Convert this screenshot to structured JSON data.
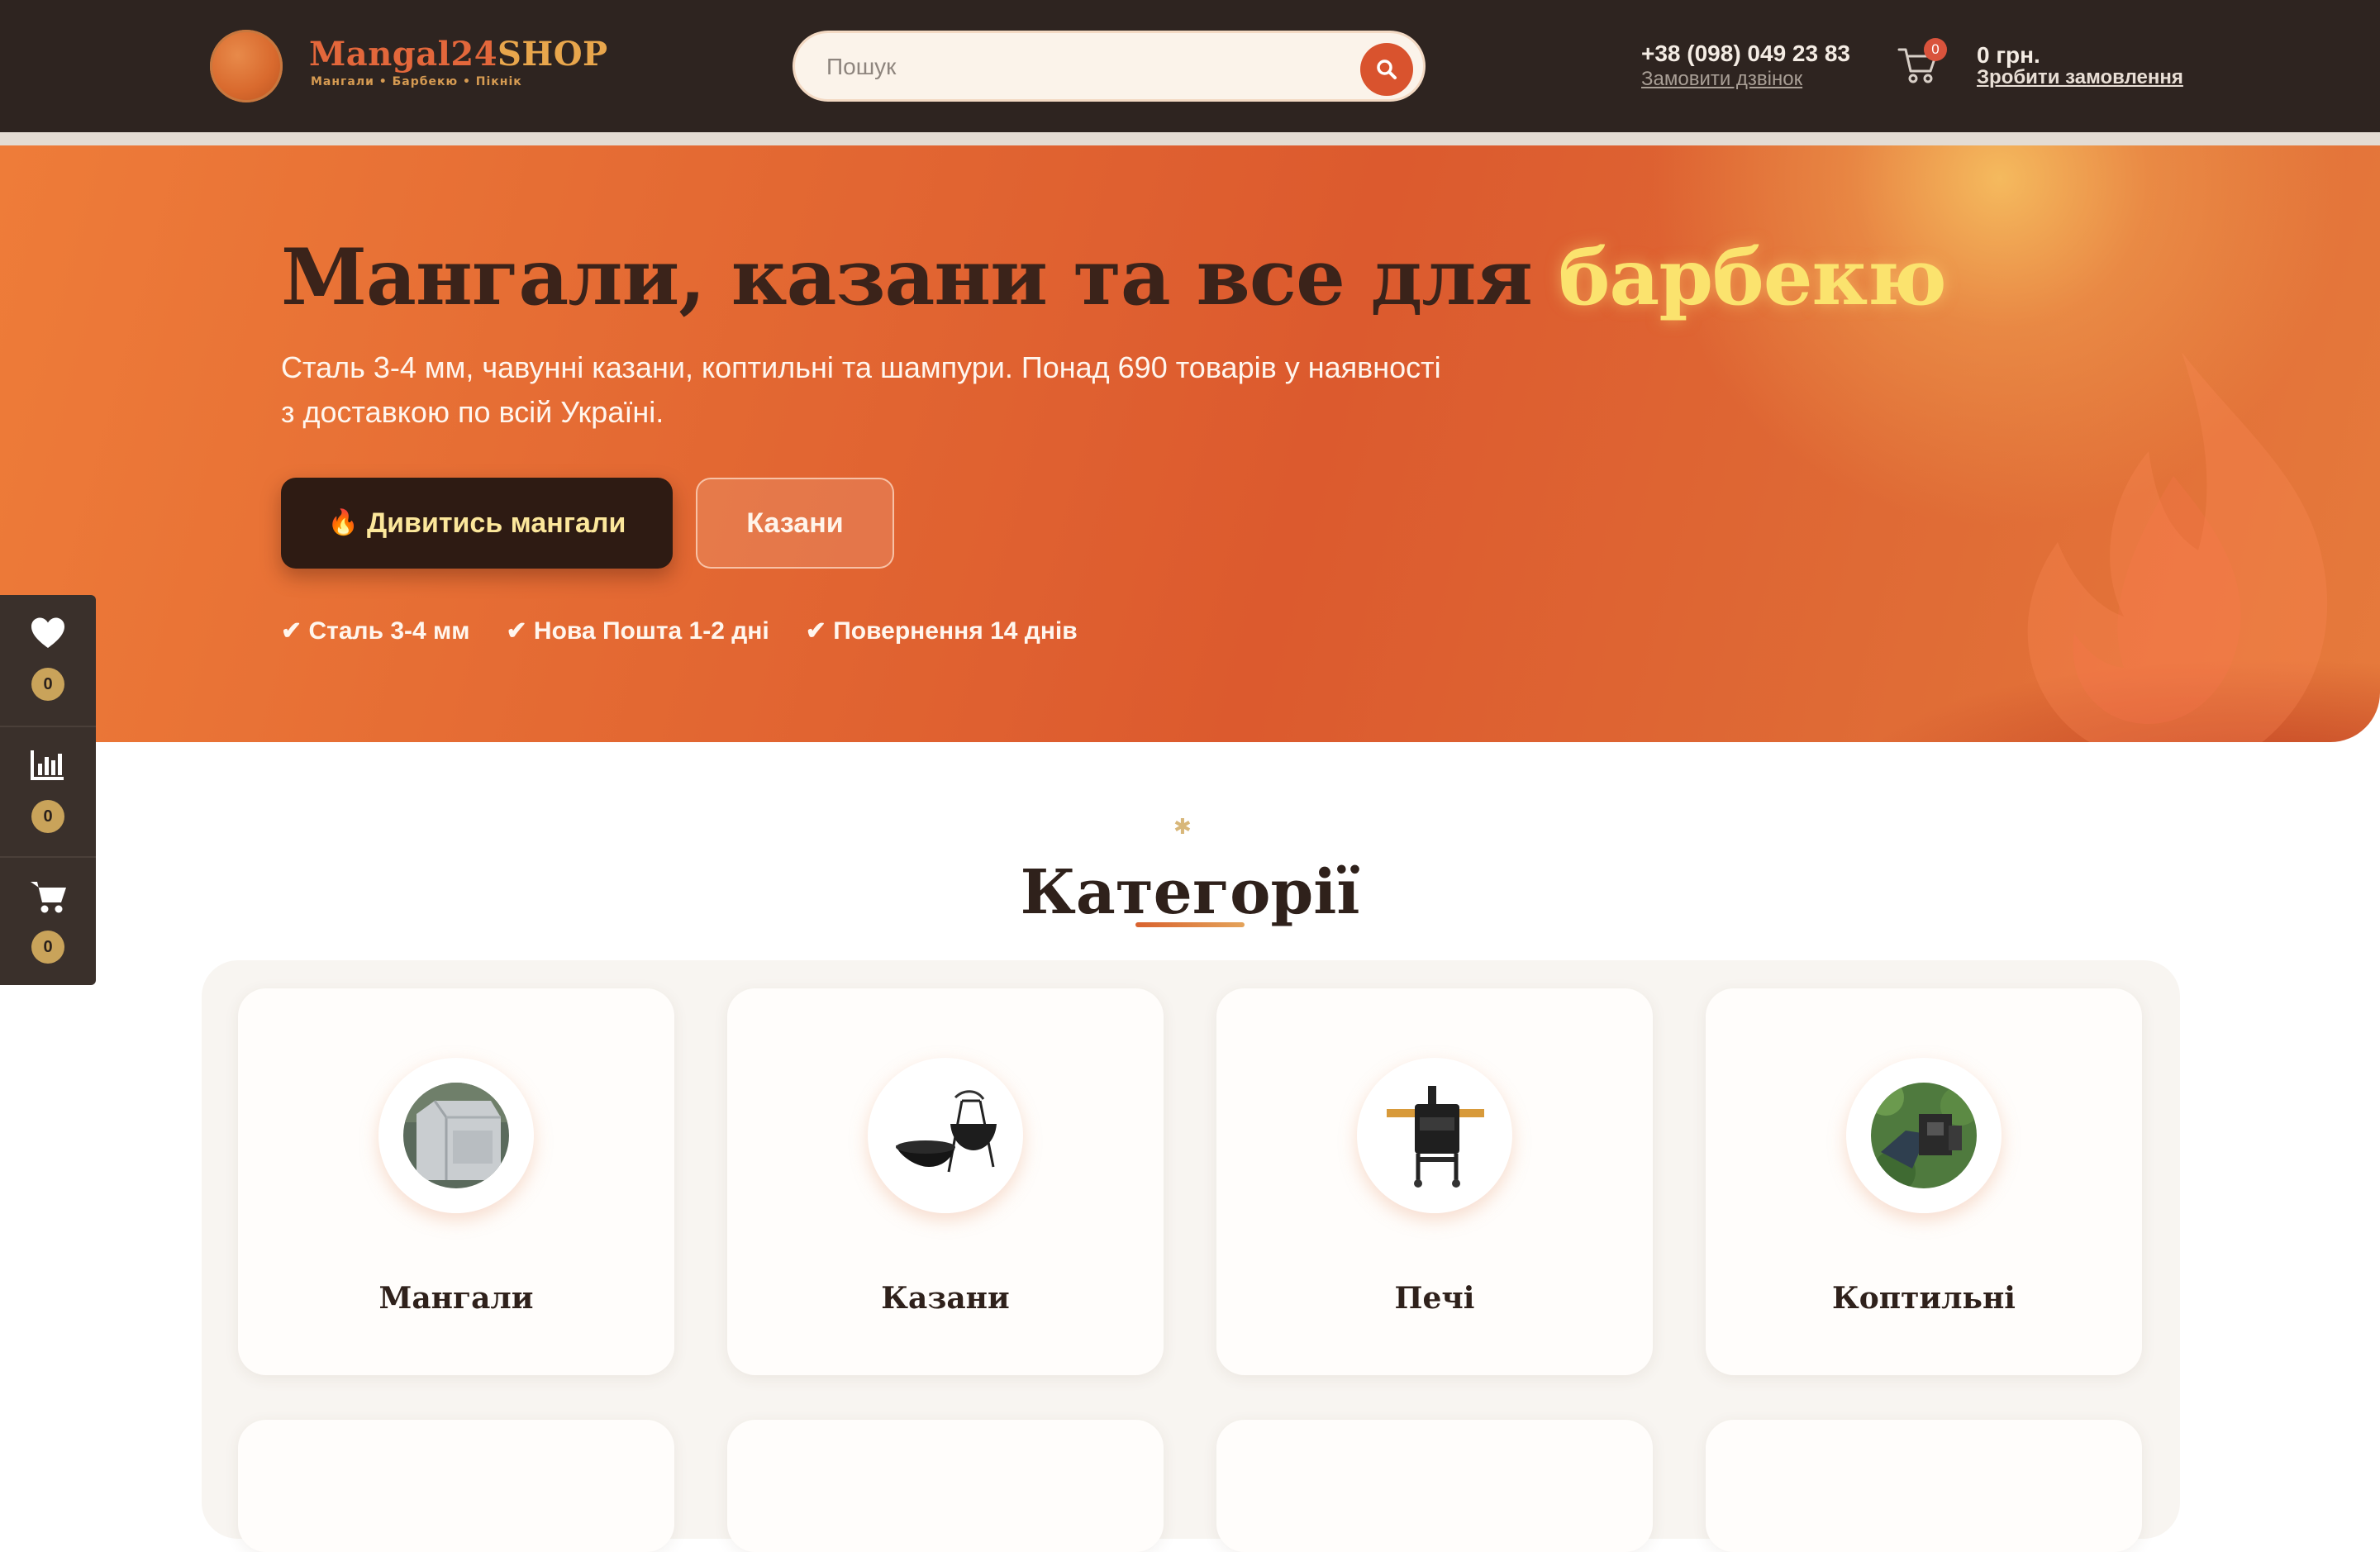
{
  "header": {
    "logo": {
      "title_part1": "Mangal24",
      "title_part2": "SHOP",
      "tagline": "Мангали • Барбекю • Пікнік"
    },
    "search": {
      "placeholder": "Пошук",
      "value": "",
      "icon": "search-icon"
    },
    "contact": {
      "phone": "+38 (098) 049 23 83",
      "callback_label": "Замовити дзвінок"
    },
    "cart": {
      "icon": "cart-icon",
      "count": "0",
      "total": "0 грн.",
      "order_label": "Зробити замовлення"
    }
  },
  "hero": {
    "title_main": "Мангали, казани та все для",
    "title_accent": "барбекю",
    "subtitle": "Сталь 3-4 мм, чавунні казани, коптильні та шампури. Понад 690 товарів у наявності з доставкою по всій Україні.",
    "primary_button": {
      "icon": "fire-icon",
      "glyph": "🔥",
      "label": "Дивитись мангали"
    },
    "secondary_button": {
      "label": "Казани"
    },
    "features": [
      "✔ Сталь 3-4 мм",
      "✔ Нова Пошта 1-2 дні",
      "✔ Повернення 14 днів"
    ]
  },
  "side_panel": {
    "items": [
      {
        "icon": "heart-icon",
        "count": "0"
      },
      {
        "icon": "compare-chart-icon",
        "count": "0"
      },
      {
        "icon": "cart-icon",
        "count": "0"
      }
    ]
  },
  "categories": {
    "heading": "Категорії",
    "items": [
      {
        "label": "Мангали",
        "icon": "grill-cover-icon"
      },
      {
        "label": "Казани",
        "icon": "cauldron-icon"
      },
      {
        "label": "Печі",
        "icon": "stove-icon"
      },
      {
        "label": "Коптильні",
        "icon": "smokehouse-icon"
      }
    ]
  },
  "colors": {
    "header_bg": "#2e2420",
    "hero_orange": "#e46a33",
    "accent_yellow": "#fbe36e",
    "button_dark": "#2e1b13",
    "search_button": "#d9532e",
    "badge_gold": "#c9a35a"
  }
}
